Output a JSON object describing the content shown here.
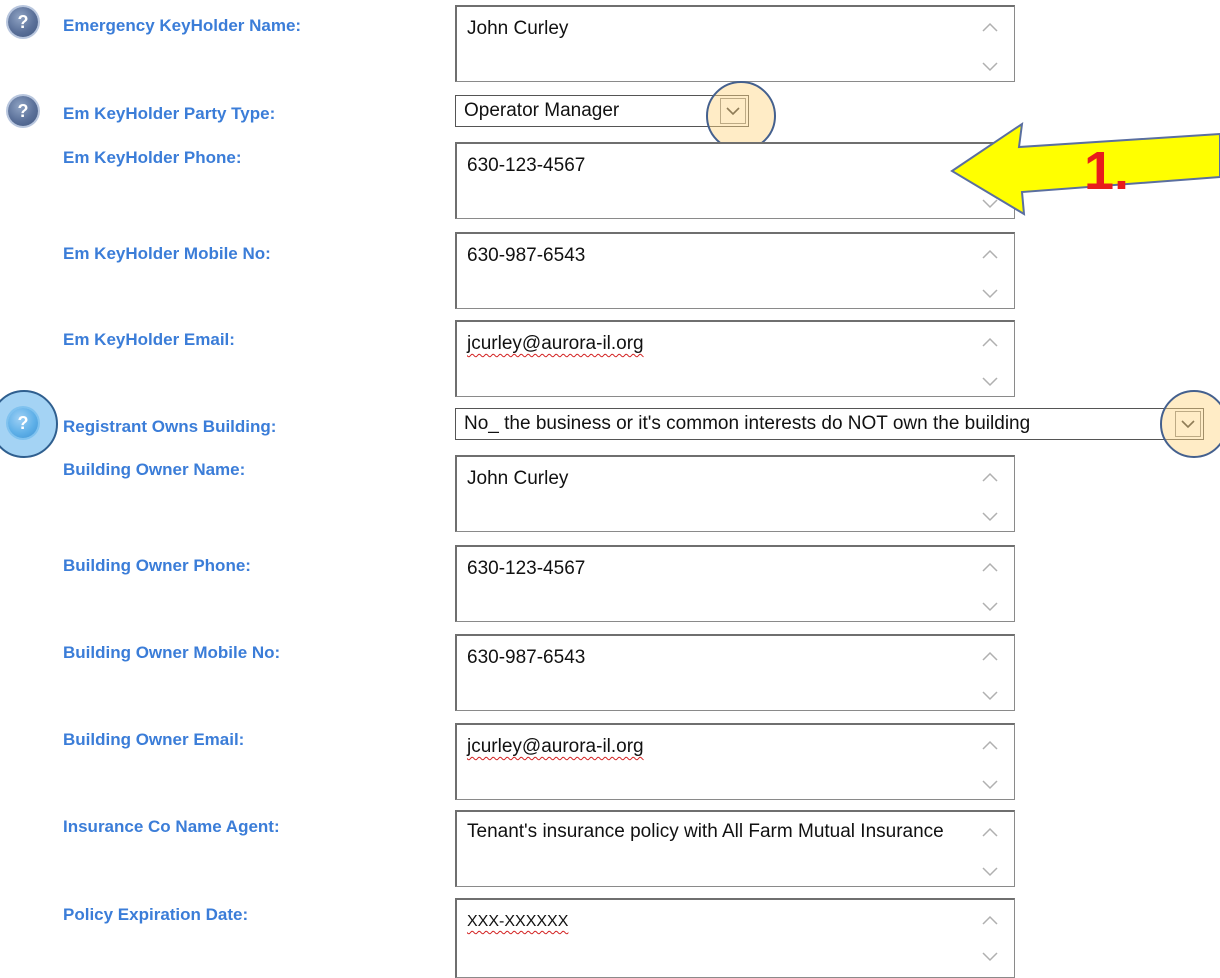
{
  "form": {
    "emergency_keyholder_name": {
      "label": "Emergency KeyHolder Name:",
      "value": "John Curley"
    },
    "em_keyholder_party_type": {
      "label": "Em KeyHolder Party Type:",
      "value": "Operator Manager"
    },
    "em_keyholder_phone": {
      "label": "Em KeyHolder Phone:",
      "value": "630-123-4567"
    },
    "em_keyholder_mobile": {
      "label": "Em KeyHolder Mobile No:",
      "value": "630-987-6543"
    },
    "em_keyholder_email": {
      "label": "Em KeyHolder Email:",
      "value": "jcurley@aurora-il.org"
    },
    "registrant_owns_building": {
      "label": "Registrant Owns Building:",
      "value": "No_ the business or it's common interests do NOT own the building"
    },
    "building_owner_name": {
      "label": "Building Owner Name:",
      "value": "John Curley"
    },
    "building_owner_phone": {
      "label": "Building Owner Phone:",
      "value": "630-123-4567"
    },
    "building_owner_mobile": {
      "label": "Building Owner Mobile No:",
      "value": "630-987-6543"
    },
    "building_owner_email": {
      "label": "Building Owner Email:",
      "value": "jcurley@aurora-il.org"
    },
    "insurance_co_name_agent": {
      "label": "Insurance Co Name Agent:",
      "value": "Tenant's insurance policy with All Farm Mutual Insurance"
    },
    "policy_expiration_date": {
      "label": "Policy Expiration Date:",
      "value": "XXX-XXXXXX"
    }
  },
  "help_icon_glyph": "?",
  "annotation": {
    "step_label": "1.",
    "arrow_color": "#ffff00",
    "arrow_outline": "#5a6fa0",
    "step_color": "#e81c1c"
  },
  "colors": {
    "label": "#3b7dd8",
    "highlight_circle": "#ffd580"
  }
}
